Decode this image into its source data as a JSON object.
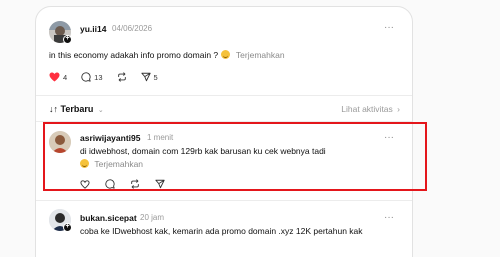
{
  "post": {
    "username": "yu.ii14",
    "date": "04/06/2026",
    "text": "in this economy adakah info promo domain ?",
    "translate": "Terjemahkan",
    "likes": "4",
    "replies": "13",
    "shares": "5"
  },
  "sort": {
    "label": "Terbaru",
    "activity": "Lihat aktivitas"
  },
  "replies": [
    {
      "username": "asriwijayanti95",
      "time": "1 menit",
      "text": "di idwebhost, domain com 129rb kak barusan ku cek webnya tadi",
      "translate": "Terjemahkan"
    },
    {
      "username": "bukan.sicepat",
      "time": "20 jam",
      "text": "coba ke IDwebhost kak, kemarin ada promo domain .xyz 12K pertahun kak"
    }
  ],
  "colors": {
    "like": "#ff3040",
    "highlight": "#e4161b",
    "muted": "#9a9a9a"
  }
}
